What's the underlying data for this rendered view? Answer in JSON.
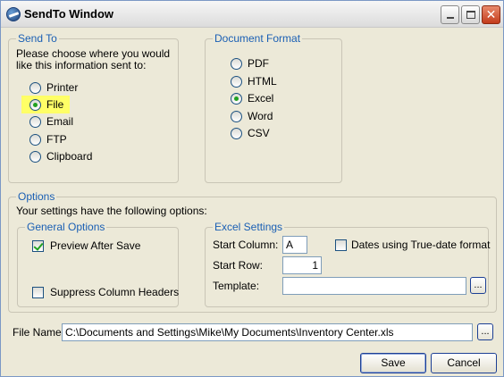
{
  "window": {
    "title": "SendTo Window",
    "buttons": {
      "minimize": "minimize-icon",
      "maximize": "maximize-icon",
      "close": "close-icon"
    }
  },
  "send_to": {
    "legend": "Send To",
    "prompt_line1": "Please choose where you would",
    "prompt_line2": "like this information sent to:",
    "options": [
      "Printer",
      "File",
      "Email",
      "FTP",
      "Clipboard"
    ],
    "selected": "File"
  },
  "document_format": {
    "legend": "Document Format",
    "options": [
      "PDF",
      "HTML",
      "Excel",
      "Word",
      "CSV"
    ],
    "selected": "Excel"
  },
  "options_section": {
    "legend": "Options",
    "description": "Your settings have the following options:"
  },
  "general_options": {
    "legend": "General Options",
    "preview_after_save": {
      "label": "Preview After Save",
      "checked": true
    },
    "suppress_column_headers": {
      "label": "Suppress Column Headers",
      "checked": false
    }
  },
  "excel_settings": {
    "legend": "Excel Settings",
    "start_column_label": "Start Column:",
    "start_column_value": "A",
    "start_row_label": "Start Row:",
    "start_row_value": "1",
    "template_label": "Template:",
    "template_value": "",
    "template_browse": "...",
    "true_date": {
      "label": "Dates using True-date format",
      "checked": false
    }
  },
  "file_name": {
    "label": "File Name:",
    "value": "C:\\Documents and Settings\\Mike\\My Documents\\Inventory Center.xls",
    "browse": "..."
  },
  "footer": {
    "save": "Save",
    "cancel": "Cancel"
  },
  "colors": {
    "legend": "#1a5fb4",
    "selected_radio": "#21a121",
    "highlight": "#ffff66"
  }
}
